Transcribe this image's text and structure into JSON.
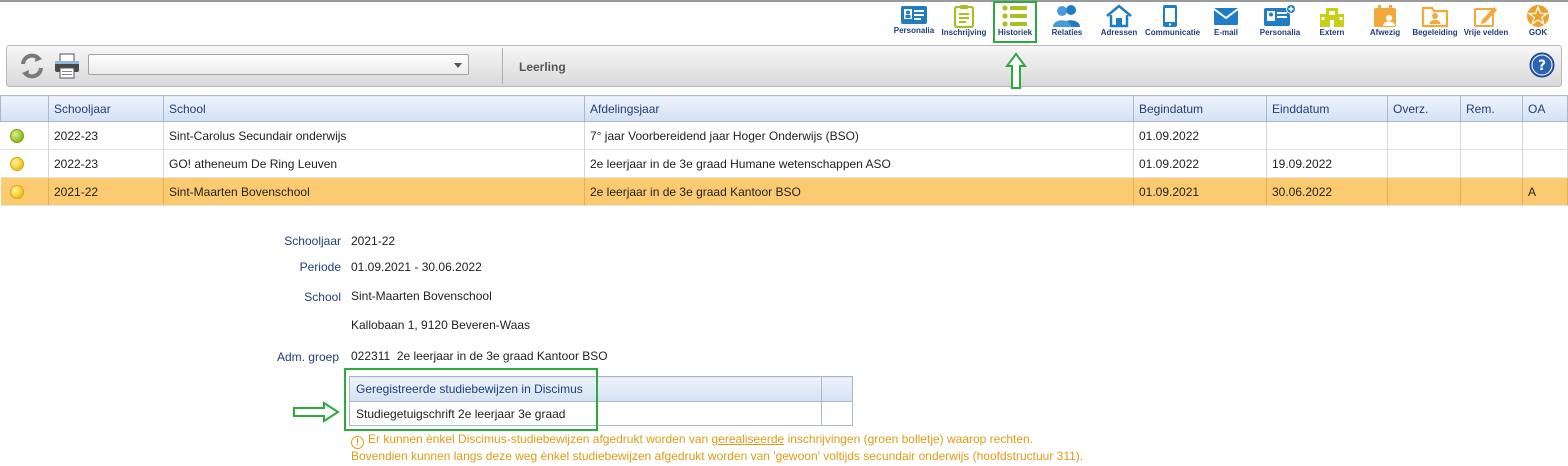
{
  "nav": {
    "items": [
      {
        "label": "Personalia",
        "icon": "id-card-icon"
      },
      {
        "label": "Inschrijving",
        "icon": "clipboard-icon"
      },
      {
        "label": "Historiek",
        "icon": "list-icon"
      },
      {
        "label": "Relaties",
        "icon": "people-icon"
      },
      {
        "label": "Adressen",
        "icon": "house-icon"
      },
      {
        "label": "Communicatie",
        "icon": "phone-icon"
      },
      {
        "label": "E-mail",
        "icon": "envelope-icon"
      },
      {
        "label": "Personalia",
        "icon": "id-card-plus-icon"
      },
      {
        "label": "Extern",
        "icon": "building-icon"
      },
      {
        "label": "Afwezig",
        "icon": "calendar-person-icon"
      },
      {
        "label": "Begeleiding",
        "icon": "folder-person-icon"
      },
      {
        "label": "Vrije velden",
        "icon": "pencil-edit-icon"
      },
      {
        "label": "GOK",
        "icon": "gok-star-icon"
      }
    ],
    "active_index": 2
  },
  "toolbar": {
    "title": "Leerling",
    "select_value": ""
  },
  "table": {
    "columns": [
      "",
      "Schooljaar",
      "School",
      "Afdelingsjaar",
      "Begindatum",
      "Einddatum",
      "Overz.",
      "Rem.",
      "OA"
    ],
    "rows": [
      {
        "status": "green",
        "schooljaar": "2022-23",
        "school": "Sint-Carolus Secundair onderwijs",
        "afdelingsjaar": "7° jaar Voorbereidend jaar Hoger Onderwijs (BSO)",
        "begindatum": "01.09.2022",
        "einddatum": "",
        "overz": "",
        "rem": "",
        "oa": ""
      },
      {
        "status": "yellow",
        "schooljaar": "2022-23",
        "school": "GO! atheneum De Ring Leuven",
        "afdelingsjaar": "2e leerjaar in de 3e graad Humane wetenschappen ASO",
        "begindatum": "01.09.2022",
        "einddatum": "19.09.2022",
        "overz": "",
        "rem": "",
        "oa": ""
      },
      {
        "status": "yellow",
        "schooljaar": "2021-22",
        "school": "Sint-Maarten Bovenschool",
        "afdelingsjaar": "2e leerjaar in de 3e graad Kantoor BSO",
        "begindatum": "01.09.2021",
        "einddatum": "30.06.2022",
        "overz": "",
        "rem": "",
        "oa": "A"
      }
    ],
    "selected_index": 2,
    "status_colors": {
      "green": "#8dbb1c",
      "yellow": "#f2c21a"
    },
    "selected_color": "#fccb71"
  },
  "detail": {
    "schooljaar_label": "Schooljaar",
    "schooljaar": "2021-22",
    "periode_label": "Periode",
    "periode": "01.09.2021 - 30.06.2022",
    "school_label": "School",
    "school": "Sint-Maarten Bovenschool",
    "adres": "Kallobaan 1, 9120 Beveren-Waas",
    "adm_label": "Adm. groep",
    "adm_code": "022311",
    "adm_groep": "2e leerjaar in de 3e graad Kantoor BSO"
  },
  "studiebewijzen": {
    "header": "Geregistreerde studiebewijzen in Discimus",
    "rows": [
      "Studiegetuigschrift 2e leerjaar 3e graad"
    ]
  },
  "warning": {
    "line1_pre": "Er kunnen ènkel Discimus-studiebewijzen afgedrukt worden van ",
    "line1_link": "gerealiseerde",
    "line1_post": " inschrijvingen (groen bolletje) waarop rechten.",
    "line2": "Bovendien kunnen langs deze weg ènkel studiebewijzen afgedrukt worden van 'gewoon' voltijds secundair onderwijs (hoofdstructuur 311).",
    "color": "#e49a12"
  },
  "colors": {
    "highlight_green": "#2daa3e",
    "nav_label": "#1f3f7a"
  }
}
